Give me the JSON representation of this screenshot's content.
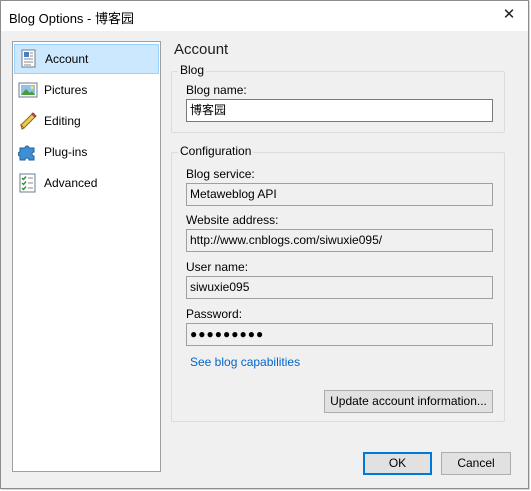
{
  "window": {
    "title": "Blog Options - 博客园",
    "close_glyph": "✕"
  },
  "sidebar": {
    "items": [
      {
        "label": "Account",
        "icon": "account-page-icon",
        "selected": true
      },
      {
        "label": "Pictures",
        "icon": "pictures-icon",
        "selected": false
      },
      {
        "label": "Editing",
        "icon": "pencil-icon",
        "selected": false
      },
      {
        "label": "Plug-ins",
        "icon": "puzzle-icon",
        "selected": false
      },
      {
        "label": "Advanced",
        "icon": "checklist-icon",
        "selected": false
      }
    ]
  },
  "main": {
    "heading": "Account",
    "blog_group": {
      "label": "Blog",
      "blog_name_label": "Blog name:",
      "blog_name_value": "博客园"
    },
    "config_group": {
      "label": "Configuration",
      "service_label": "Blog service:",
      "service_value": "Metaweblog API",
      "website_label": "Website address:",
      "website_value": "http://www.cnblogs.com/siwuxie095/",
      "username_label": "User name:",
      "username_value": "siwuxie095",
      "password_label": "Password:",
      "password_masked": "●●●●●●●●●",
      "capabilities_link": "See blog capabilities",
      "update_button": "Update account information..."
    }
  },
  "footer": {
    "ok_label": "OK",
    "cancel_label": "Cancel"
  },
  "colors": {
    "selection_bg": "#cce8ff",
    "link": "#0066cc",
    "default_button_border": "#0078d7"
  }
}
